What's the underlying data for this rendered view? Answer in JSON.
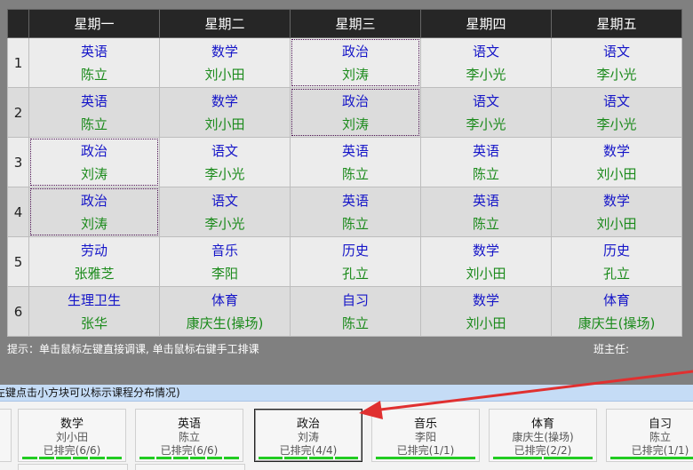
{
  "timetable": {
    "days": [
      "星期一",
      "星期二",
      "星期三",
      "星期四",
      "星期五"
    ],
    "rows": [
      {
        "period": "1",
        "cells": [
          {
            "subject": "英语",
            "teacher": "陈立"
          },
          {
            "subject": "数学",
            "teacher": "刘小田"
          },
          {
            "subject": "政治",
            "teacher": "刘涛",
            "highlight": true
          },
          {
            "subject": "语文",
            "teacher": "李小光"
          },
          {
            "subject": "语文",
            "teacher": "李小光"
          }
        ]
      },
      {
        "period": "2",
        "cells": [
          {
            "subject": "英语",
            "teacher": "陈立"
          },
          {
            "subject": "数学",
            "teacher": "刘小田"
          },
          {
            "subject": "政治",
            "teacher": "刘涛",
            "highlight": true
          },
          {
            "subject": "语文",
            "teacher": "李小光"
          },
          {
            "subject": "语文",
            "teacher": "李小光"
          }
        ]
      },
      {
        "period": "3",
        "cells": [
          {
            "subject": "政治",
            "teacher": "刘涛",
            "highlight": true
          },
          {
            "subject": "语文",
            "teacher": "李小光"
          },
          {
            "subject": "英语",
            "teacher": "陈立"
          },
          {
            "subject": "英语",
            "teacher": "陈立"
          },
          {
            "subject": "数学",
            "teacher": "刘小田"
          }
        ]
      },
      {
        "period": "4",
        "cells": [
          {
            "subject": "政治",
            "teacher": "刘涛",
            "highlight": true
          },
          {
            "subject": "语文",
            "teacher": "李小光"
          },
          {
            "subject": "英语",
            "teacher": "陈立"
          },
          {
            "subject": "英语",
            "teacher": "陈立"
          },
          {
            "subject": "数学",
            "teacher": "刘小田"
          }
        ]
      },
      {
        "period": "5",
        "cells": [
          {
            "subject": "劳动",
            "teacher": "张雅芝"
          },
          {
            "subject": "音乐",
            "teacher": "李阳"
          },
          {
            "subject": "历史",
            "teacher": "孔立"
          },
          {
            "subject": "数学",
            "teacher": "刘小田"
          },
          {
            "subject": "历史",
            "teacher": "孔立"
          }
        ]
      },
      {
        "period": "6",
        "cells": [
          {
            "subject": "生理卫生",
            "teacher": "张华"
          },
          {
            "subject": "体育",
            "teacher": "康庆生(操场)"
          },
          {
            "subject": "自习",
            "teacher": "陈立"
          },
          {
            "subject": "数学",
            "teacher": "刘小田"
          },
          {
            "subject": "体育",
            "teacher": "康庆生(操场)"
          }
        ]
      }
    ]
  },
  "footer": {
    "hint": "提示：单击鼠标左键直接调课, 单击鼠标右键手工排课",
    "head_teacher_label": "班主任:"
  },
  "panel": {
    "bar_text": "左键点击小方块可以标示课程分布情况)",
    "cards": [
      {
        "subject": "数学",
        "teacher": "刘小田",
        "status": "已排完(6/6)",
        "slots": 6
      },
      {
        "subject": "英语",
        "teacher": "陈立",
        "status": "已排完(6/6)",
        "slots": 6
      },
      {
        "subject": "政治",
        "teacher": "刘涛",
        "status": "已排完(4/4)",
        "slots": 4,
        "selected": true
      },
      {
        "subject": "音乐",
        "teacher": "李阳",
        "status": "已排完(1/1)",
        "slots": 1
      },
      {
        "subject": "体育",
        "teacher": "康庆生(操场)",
        "status": "已排完(2/2)",
        "slots": 2
      },
      {
        "subject": "自习",
        "teacher": "陈立",
        "status": "已排完(1/1)",
        "slots": 1
      }
    ]
  },
  "colors": {
    "subject": "#1515c8",
    "teacher": "#1a8a1a",
    "progress": "#22cc22",
    "arrow": "#e03030",
    "header_bg": "#262626",
    "panel_bar": "#c5dcf6"
  }
}
